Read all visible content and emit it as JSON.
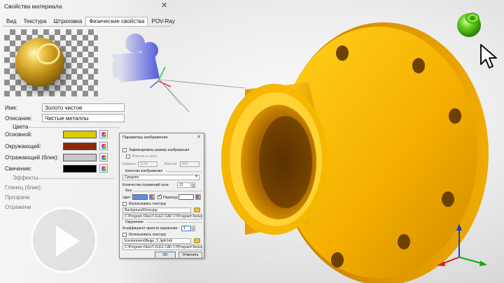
{
  "panel": {
    "title": "Свойства материала",
    "tabs": [
      "Вид",
      "Текстура",
      "Штриховка",
      "Физические свойства",
      "POV-Ray"
    ],
    "name_label": "Имя:",
    "name_value": "Золото чистое",
    "desc_label": "Описание:",
    "desc_value": "Чистые металлы",
    "colors_group": "Цвета",
    "colors": [
      {
        "label": "Основной:",
        "hex": "#d9cf00"
      },
      {
        "label": "Окружающий:",
        "hex": "#8a2a0a"
      },
      {
        "label": "Отражающий (блик):",
        "hex": "#c9c9c9"
      },
      {
        "label": "Свечение:",
        "hex": "#000000"
      }
    ],
    "effects_group": "Эффекты",
    "effects_rows": [
      "Глянец (блик):",
      "Прозрачн",
      "Отражени"
    ]
  },
  "dialog": {
    "title": "Параметры изображения",
    "fix_size_label": "Зафиксировать размер изображения",
    "fit_label": "Вписать в окно",
    "width_label": "Ширина:",
    "width_value": "1124",
    "height_label": "Высота:",
    "height_value": "840",
    "quality_group": "Качество изображения",
    "quality_value": "Среднее",
    "reflections_label": "Количество отражений луча:",
    "reflections_value": "12",
    "bg_group": "Фон",
    "color_label": "Цвет:",
    "gradient_label": "Переход:",
    "use_texture_label": "Использовать текстуру",
    "bg_texture_name": "Background\\Grey.jpg",
    "bg_texture_path": "C:\\Program Files\\T-FLEX CAD 17\\Program\\Textures\\",
    "env_group": "Окружение",
    "env_brightness_label": "Коэффициент яркости окружения :",
    "env_brightness_value": "1",
    "env_use_texture_label": "Использовать текстуру",
    "env_texture_name": "Environment\\Beige_3_light.hdr",
    "env_texture_path": "C:\\Program Files\\T-FLEX CAD 17\\Program\\Textures\\",
    "ok_label": "OK",
    "cancel_label": "Отменить"
  },
  "colors": {
    "part_gold": "#f5b400",
    "camera_blue": "#1f2bd6",
    "ball_green": "#55c81a"
  },
  "icons": [
    "close-icon",
    "play-icon",
    "camera-icon",
    "green-ball-icon",
    "mouse-cursor-icon",
    "axes-triad-icon",
    "folder-icon",
    "color-picker-icon"
  ]
}
